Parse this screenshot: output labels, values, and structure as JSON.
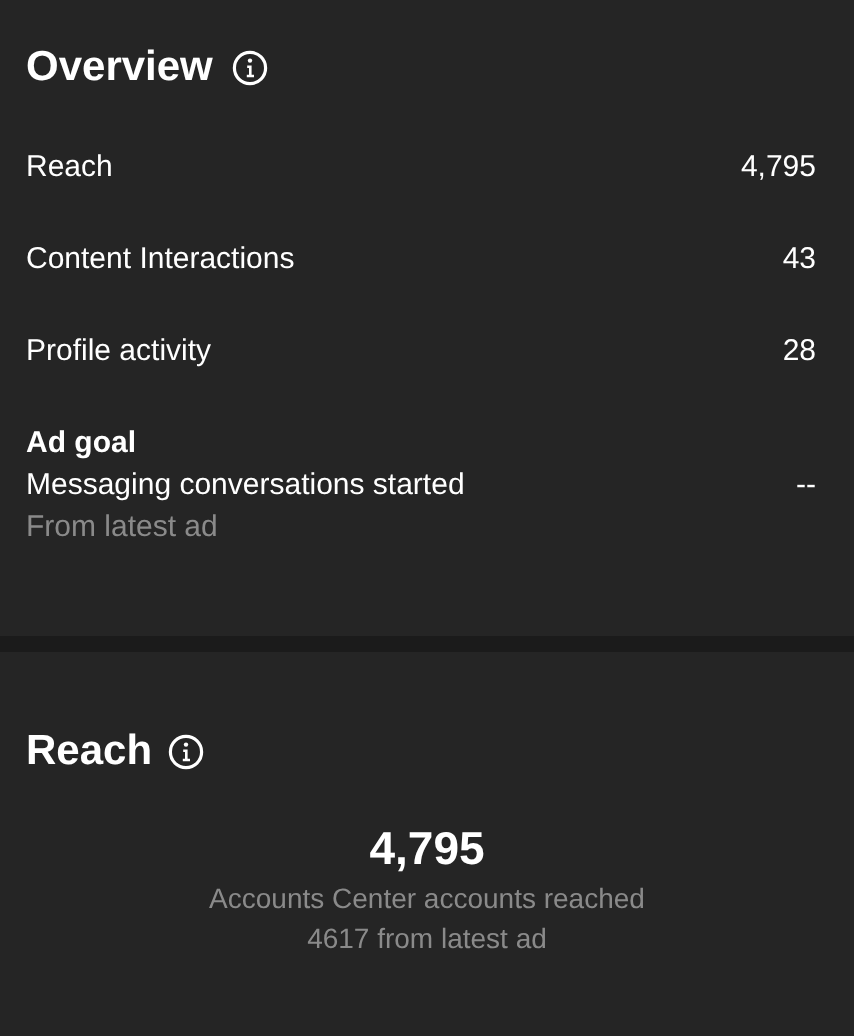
{
  "overview": {
    "title": "Overview",
    "metrics": [
      {
        "label": "Reach",
        "value": "4,795"
      },
      {
        "label": "Content Interactions",
        "value": "43"
      },
      {
        "label": "Profile activity",
        "value": "28"
      }
    ],
    "ad_goal": {
      "title": "Ad goal",
      "label": "Messaging conversations started",
      "note": "From latest ad",
      "value": "--"
    }
  },
  "reach": {
    "title": "Reach",
    "value": "4,795",
    "caption": "Accounts Center accounts reached",
    "note": "4617 from latest ad"
  }
}
